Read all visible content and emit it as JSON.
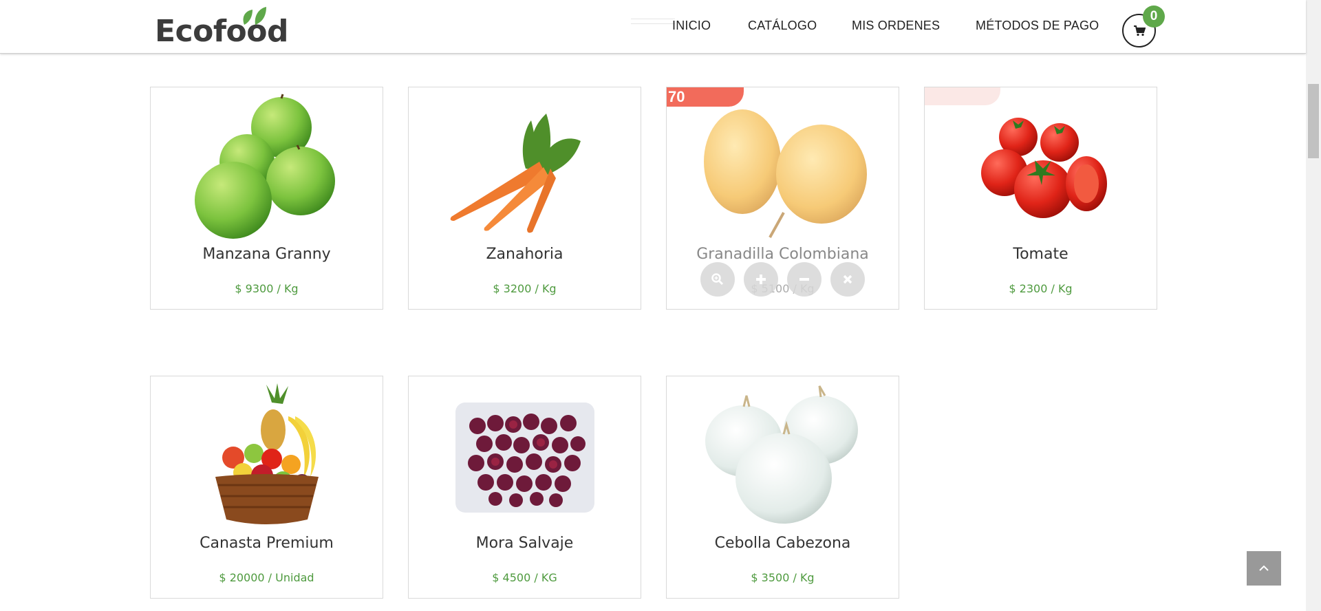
{
  "brand": {
    "name": "Ecofood"
  },
  "nav": {
    "items": [
      "INICIO",
      "CATÁLOGO",
      "MIS ORDENES",
      "MÉTODOS DE PAGO"
    ]
  },
  "cart": {
    "count": "0",
    "icon": "shopping-cart-icon"
  },
  "colors": {
    "brand_green": "#5fa84a",
    "price_green": "#4e9a3e",
    "sale_red": "#f26b5b"
  },
  "products": [
    {
      "name": "Manzana Granny",
      "price": "$ 9300 / Kg"
    },
    {
      "name": "Zanahoria",
      "price": "$ 3200 / Kg"
    },
    {
      "name": "Granadilla Colombiana",
      "price": "$ 5100 / Kg",
      "badge": "70"
    },
    {
      "name": "Tomate",
      "price": "$ 2300 / Kg"
    },
    {
      "name": "Canasta Premium",
      "price": "$ 20000 / Unidad"
    },
    {
      "name": "Mora Salvaje",
      "price": "$ 4500 / KG"
    },
    {
      "name": "Cebolla Cabezona",
      "price": "$ 3500 / Kg"
    }
  ],
  "quick_actions": [
    "zoom-icon",
    "plus-icon",
    "minus-icon",
    "close-icon"
  ],
  "back_to_top": {
    "icon": "chevron-up-icon"
  }
}
